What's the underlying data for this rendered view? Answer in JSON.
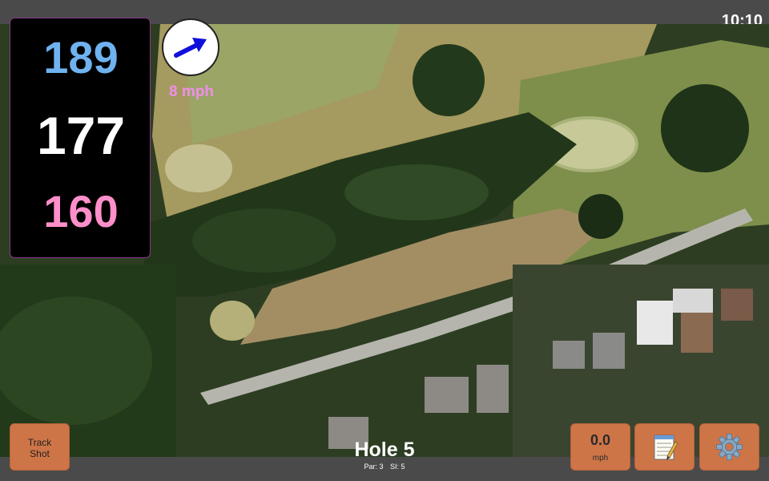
{
  "status": {
    "time": "10:10"
  },
  "yardages": {
    "back": "189",
    "middle": "177",
    "front": "160"
  },
  "wind": {
    "speed": "8 mph",
    "direction_icon": "arrow-icon",
    "arrow_color": "#1010dd"
  },
  "hole": {
    "title": "Hole 5",
    "par": "Par: 3",
    "si": "SI: 5"
  },
  "buttons": {
    "track_shot_line1": "Track",
    "track_shot_line2": "Shot",
    "speed_value": "0.0",
    "speed_unit": "mph",
    "notes_icon": "notepad-icon",
    "settings_icon": "gear-icon"
  },
  "colors": {
    "button": "#ce7548",
    "back_yardage": "#6fb2ef",
    "middle_yardage": "#ffffff",
    "front_yardage": "#ff8fca",
    "wind_text": "#ef8fea",
    "bar": "#4a4a4a"
  }
}
